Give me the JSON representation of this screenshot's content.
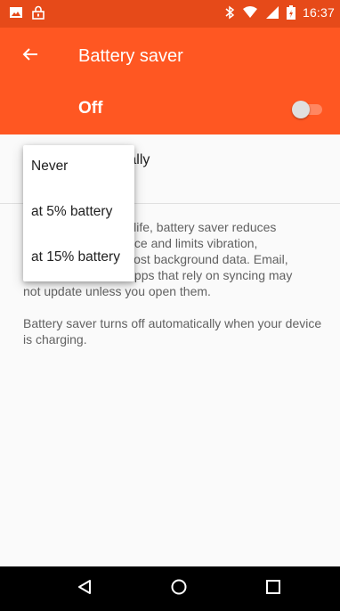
{
  "status_bar": {
    "time": "16:37",
    "icons": [
      "image-icon",
      "lock-icon",
      "bluetooth-icon",
      "wifi-icon",
      "signal-icon",
      "battery-icon"
    ],
    "background": "#e64a19"
  },
  "toolbar": {
    "title": "Battery saver",
    "back_icon": "arrow-back-icon",
    "background": "#ff5722"
  },
  "master_switch": {
    "label": "Off",
    "state": "off"
  },
  "preference": {
    "title_partial": "tically"
  },
  "description": {
    "paragraph1_partial": [
      "ttery life, battery saver reduces",
      "rmance and limits vibration,",
      "nd most background data. Email,",
      "ner apps that rely on syncing may",
      "not update unless you open them."
    ],
    "paragraph2": "Battery saver turns off automatically when your device is charging."
  },
  "popup_menu": {
    "items": [
      "Never",
      "at 5% battery",
      "at 15% battery"
    ]
  },
  "nav_bar": {
    "icons": [
      "nav-back-icon",
      "nav-home-icon",
      "nav-recents-icon"
    ]
  }
}
